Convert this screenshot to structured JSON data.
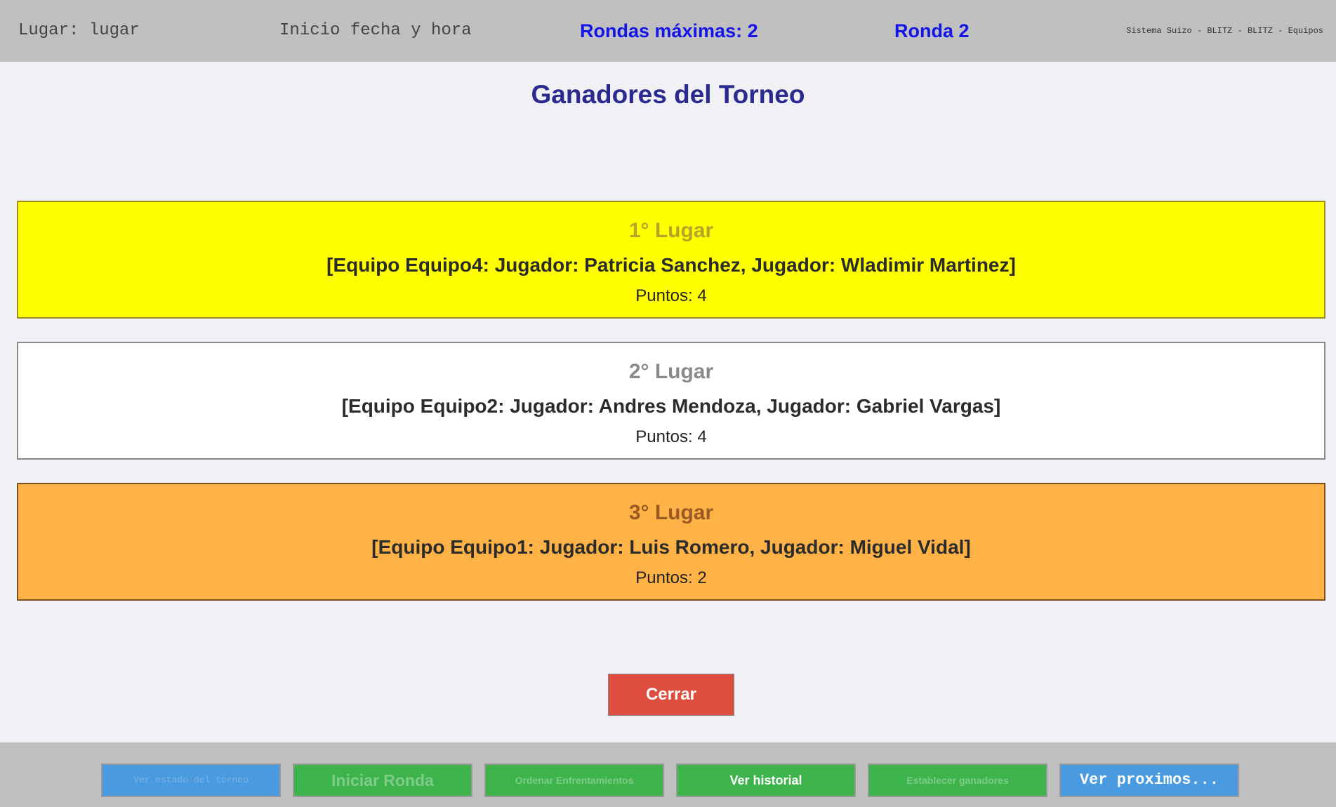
{
  "header": {
    "location": "Lugar: lugar",
    "start": "Inicio fecha y hora",
    "max_rounds": "Rondas máximas: 2",
    "round": "Ronda 2",
    "system": "Sistema Suizo - BLITZ - BLITZ - Equipos"
  },
  "main": {
    "title": "Ganadores del Torneo",
    "winners": [
      {
        "place": "1° Lugar",
        "team": "[Equipo Equipo4: Jugador: Patricia Sanchez, Jugador: Wladimir Martinez]",
        "points": "Puntos: 4",
        "bg": "#ffff00",
        "border": "#9a8f22",
        "place_color": "#b3a52a"
      },
      {
        "place": "2° Lugar",
        "team": "[Equipo Equipo2: Jugador: Andres Mendoza, Jugador: Gabriel Vargas]",
        "points": "Puntos: 4",
        "bg": "#ffffff",
        "border": "#888888",
        "place_color": "#8a8a8a"
      },
      {
        "place": "3° Lugar",
        "team": "[Equipo Equipo1: Jugador: Luis Romero, Jugador: Miguel Vidal]",
        "points": "Puntos: 2",
        "bg": "#ffb347",
        "border": "#7a5020",
        "place_color": "#9a5a25"
      }
    ],
    "close_label": "Cerrar"
  },
  "footer": {
    "buttons": [
      {
        "label": "Ver estado del torneo",
        "bg": "#4a9ae0",
        "color": "#7ab2e6",
        "enabled": false
      },
      {
        "label": "Iniciar Ronda",
        "bg": "#3cb44b",
        "color": "#7fcc88",
        "enabled": false
      },
      {
        "label": "Ordenar Enfrentamientos",
        "bg": "#3cb44b",
        "color": "#7fcc88",
        "enabled": false
      },
      {
        "label": "Ver historial",
        "bg": "#3cb44b",
        "color": "#ffffff",
        "enabled": true
      },
      {
        "label": "Establecer ganadores",
        "bg": "#3cb44b",
        "color": "#7fcc88",
        "enabled": false
      },
      {
        "label": "Ver proximos...",
        "bg": "#4a9ae0",
        "color": "#ffffff",
        "enabled": true
      }
    ]
  }
}
